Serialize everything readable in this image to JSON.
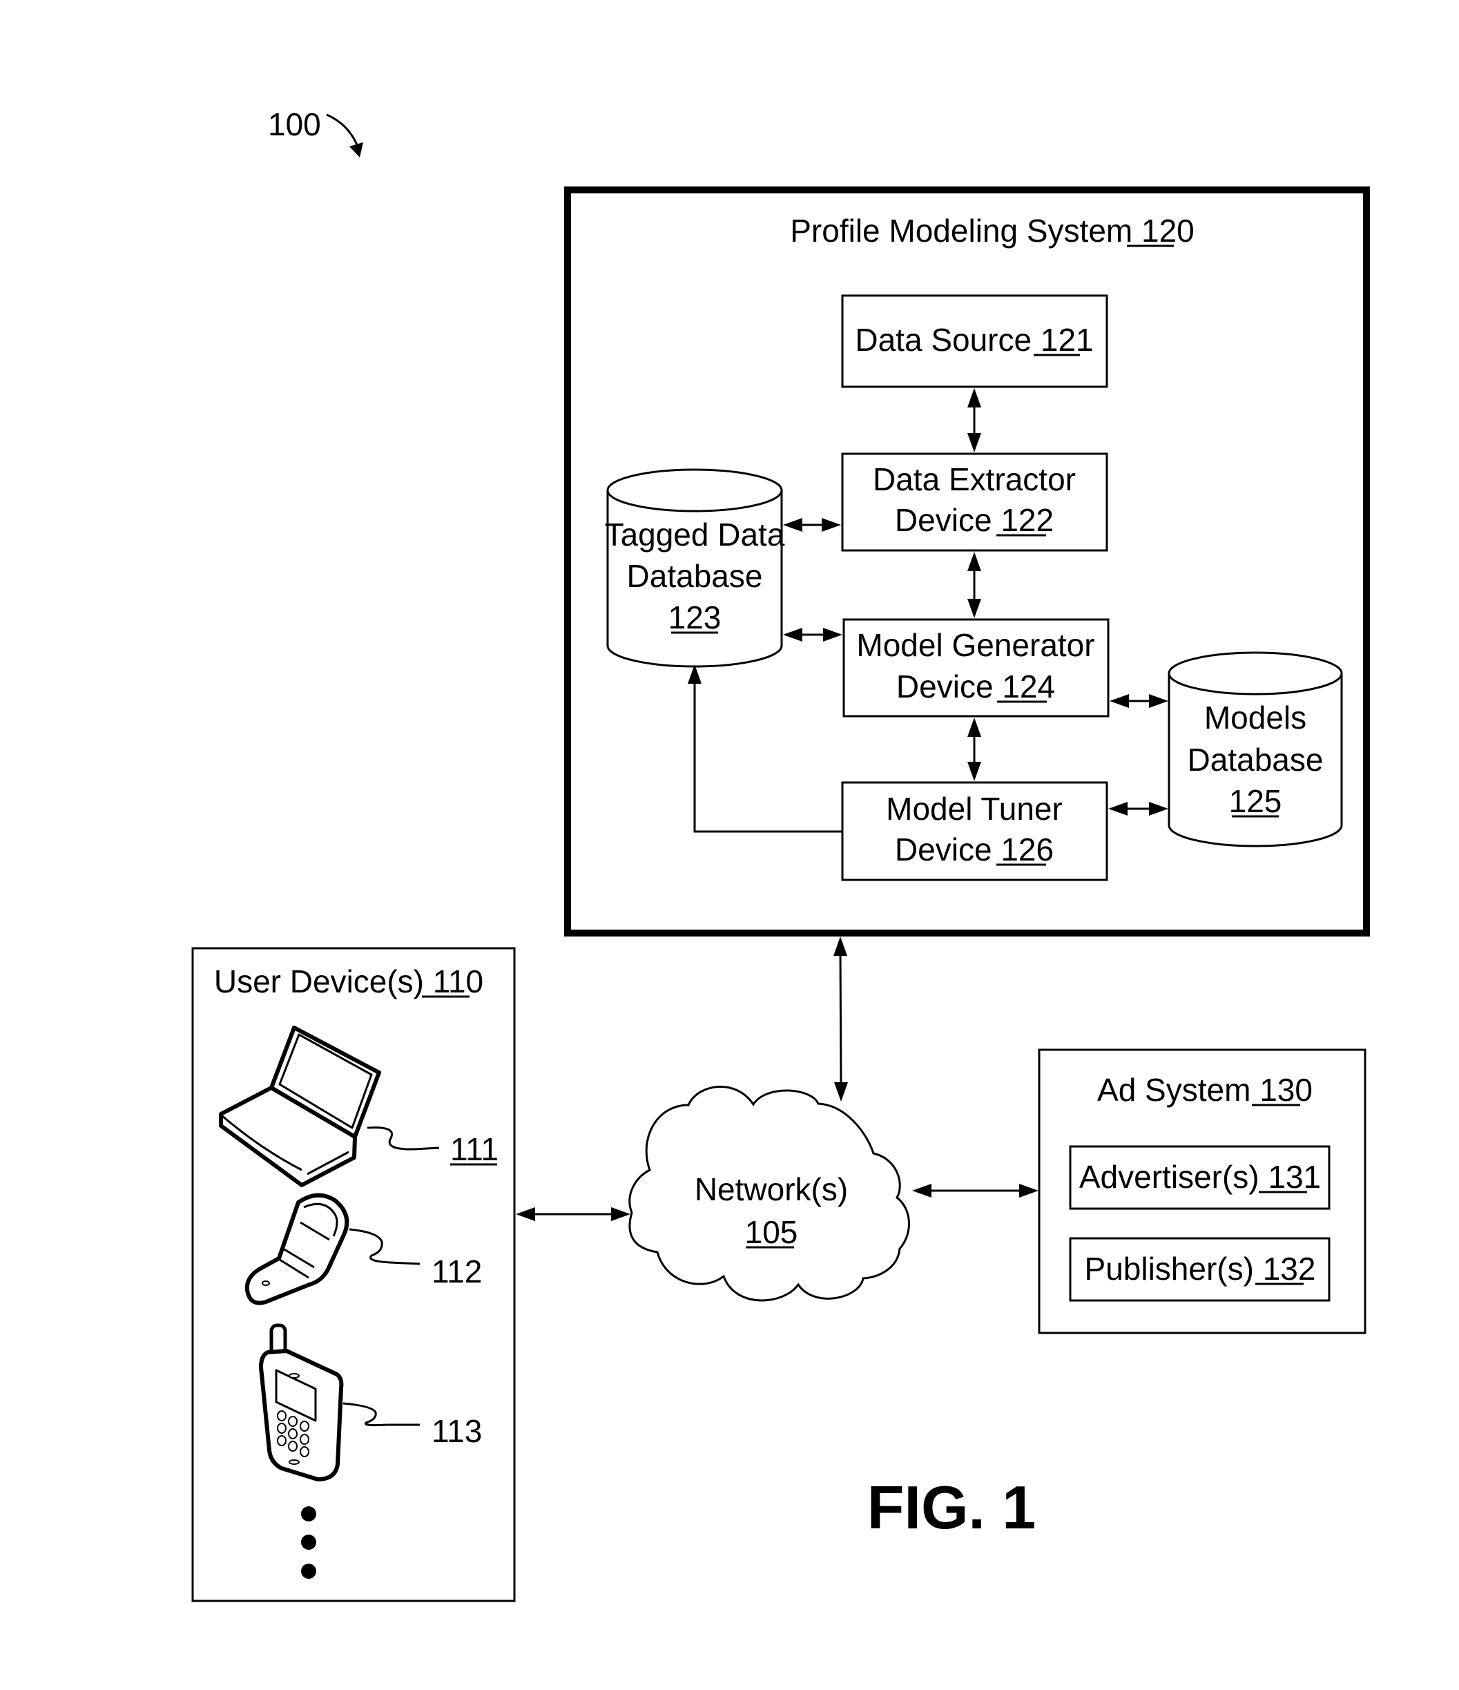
{
  "figure": {
    "ref_label": "100",
    "caption": "FIG. 1"
  },
  "profile_system": {
    "title": "Profile Modeling System",
    "ref": "120",
    "data_source": {
      "name": "Data Source",
      "ref": "121"
    },
    "data_extractor": {
      "line1": "Data Extractor",
      "line2": "Device",
      "ref": "122"
    },
    "tagged_db": {
      "line1": "Tagged Data",
      "line2": "Database",
      "ref": "123"
    },
    "model_generator": {
      "line1": "Model Generator",
      "line2": "Device",
      "ref": "124"
    },
    "models_db": {
      "line1": "Models",
      "line2": "Database",
      "ref": "125"
    },
    "model_tuner": {
      "line1": "Model Tuner",
      "line2": "Device",
      "ref": "126"
    }
  },
  "user_devices": {
    "title": "User Device(s)",
    "ref": "110",
    "devices": [
      {
        "icon": "laptop-icon",
        "ref": "111",
        "ref_underlined": true
      },
      {
        "icon": "flip-phone-icon",
        "ref": "112",
        "ref_underlined": false
      },
      {
        "icon": "mobile-phone-icon",
        "ref": "113",
        "ref_underlined": false
      }
    ],
    "more_indicator": "ellipsis-vertical-icon"
  },
  "network": {
    "name": "Network(s)",
    "ref": "105"
  },
  "ad_system": {
    "title": "Ad System",
    "ref": "130",
    "advertisers": {
      "name": "Advertiser(s)",
      "ref": "131"
    },
    "publishers": {
      "name": "Publisher(s)",
      "ref": "132"
    }
  }
}
